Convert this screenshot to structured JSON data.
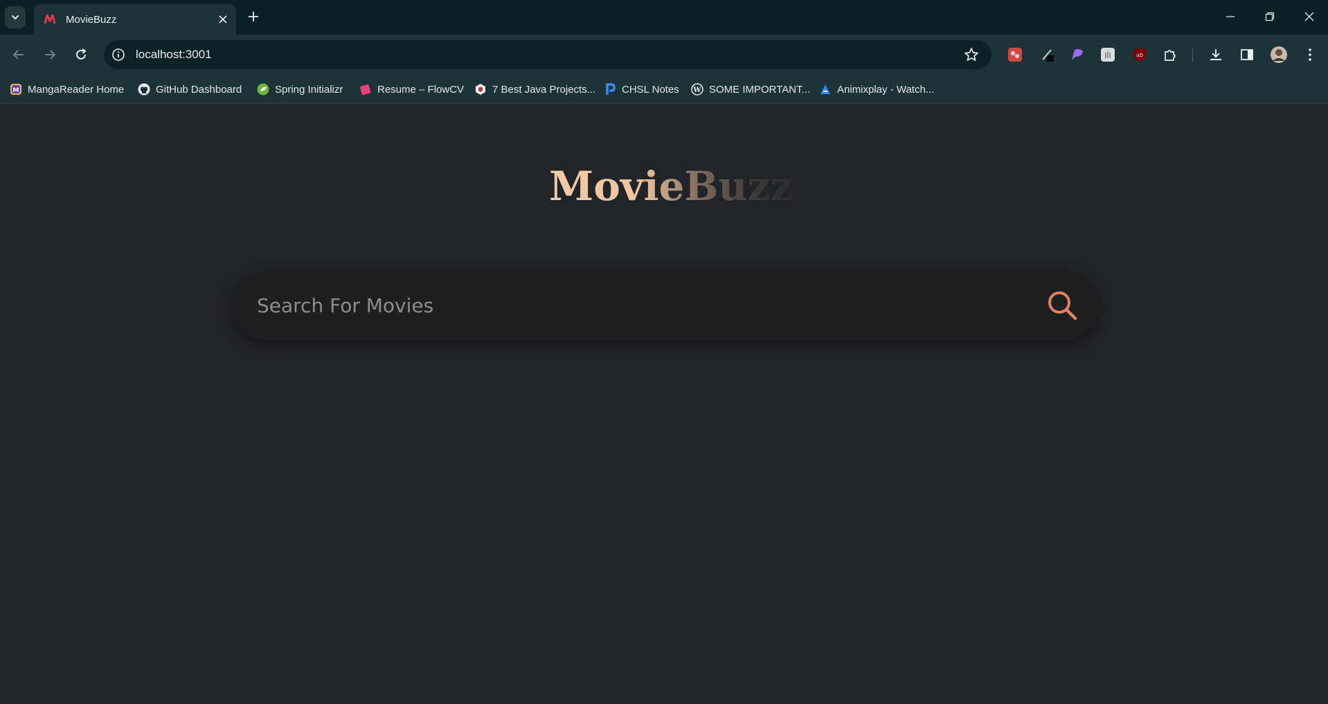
{
  "browser": {
    "tab": {
      "title": "MovieBuzz"
    },
    "url": "localhost:3001",
    "bookmarks": [
      {
        "label": "MangaReader Home",
        "icon": "mangareader-icon"
      },
      {
        "label": "GitHub Dashboard",
        "icon": "github-icon"
      },
      {
        "label": "Spring Initializr",
        "icon": "spring-icon"
      },
      {
        "label": "Resume – FlowCV",
        "icon": "flowcv-icon"
      },
      {
        "label": "7 Best Java Projects...",
        "icon": "java-projects-icon"
      },
      {
        "label": "CHSL Notes",
        "icon": "chsl-notes-icon"
      },
      {
        "label": "SOME IMPORTANT...",
        "icon": "wordpress-icon"
      },
      {
        "label": "Animixplay - Watch...",
        "icon": "animixplay-icon"
      }
    ]
  },
  "app": {
    "logo": "MovieBuzz",
    "search": {
      "placeholder": "Search For Movies",
      "value": ""
    }
  },
  "colors": {
    "page_bg": "#212428",
    "accent": "#e0825f",
    "logo_start": "#f4cba8"
  }
}
